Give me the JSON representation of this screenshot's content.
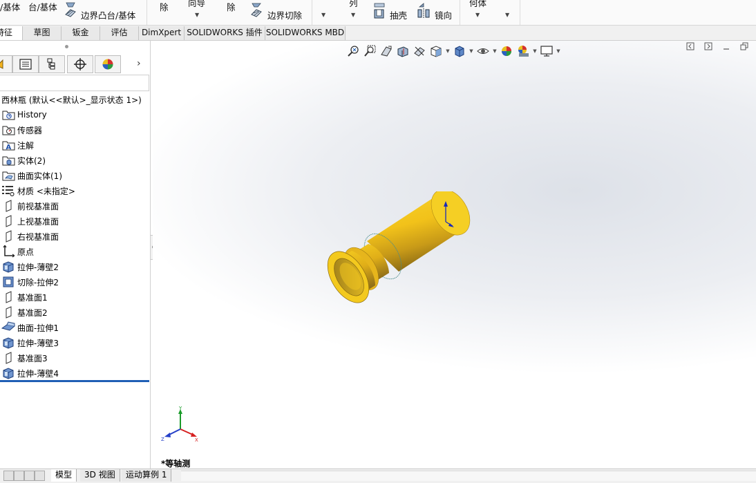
{
  "ribbon": {
    "items": [
      {
        "id": "boss_base_cut",
        "label": "/基体"
      },
      {
        "id": "boss_base",
        "label": "台/基体"
      },
      {
        "id": "boundary_boss",
        "label": "边界凸台/基体"
      },
      {
        "id": "cut_1",
        "label": "除"
      },
      {
        "id": "guide",
        "label": "向导"
      },
      {
        "id": "cut_2",
        "label": "除"
      },
      {
        "id": "boundary_cut",
        "label": "边界切除"
      },
      {
        "id": "pattern",
        "label": "列"
      },
      {
        "id": "shell",
        "label": "抽壳"
      },
      {
        "id": "mirror",
        "label": "镜向"
      },
      {
        "id": "geometry",
        "label": "何体"
      }
    ]
  },
  "tabs": [
    {
      "label": "特征"
    },
    {
      "label": "草图"
    },
    {
      "label": "钣金"
    },
    {
      "label": "评估"
    },
    {
      "label": "DimXpert"
    },
    {
      "label": "SOLIDWORKS 插件"
    },
    {
      "label": "SOLIDWORKS MBD"
    }
  ],
  "tree": {
    "root": "西林瓶  (默认<<默认>_显示状态 1>)",
    "items": [
      {
        "label": "History",
        "icon": "history-folder-icon"
      },
      {
        "label": "传感器",
        "icon": "sensor-folder-icon"
      },
      {
        "label": "注解",
        "icon": "annotation-folder-icon"
      },
      {
        "label": "实体(2)",
        "icon": "solid-bodies-folder-icon"
      },
      {
        "label": "曲面实体(1)",
        "icon": "surface-bodies-folder-icon"
      },
      {
        "label": "材质 <未指定>",
        "icon": "material-icon"
      },
      {
        "label": "前视基准面",
        "icon": "plane-icon"
      },
      {
        "label": "上视基准面",
        "icon": "plane-icon"
      },
      {
        "label": "右视基准面",
        "icon": "plane-icon"
      },
      {
        "label": "原点",
        "icon": "origin-icon"
      },
      {
        "label": "拉伸-薄壁2",
        "icon": "extrude-thin-icon"
      },
      {
        "label": "切除-拉伸2",
        "icon": "cut-extrude-icon"
      },
      {
        "label": "基准面1",
        "icon": "plane-icon"
      },
      {
        "label": "基准面2",
        "icon": "plane-icon"
      },
      {
        "label": "曲面-拉伸1",
        "icon": "surface-extrude-icon"
      },
      {
        "label": "拉伸-薄壁3",
        "icon": "extrude-thin-icon"
      },
      {
        "label": "基准面3",
        "icon": "plane-icon"
      },
      {
        "label": "拉伸-薄壁4",
        "icon": "extrude-thin-icon"
      }
    ]
  },
  "graphics": {
    "view_label": "*等轴测",
    "triad": {
      "x": "X",
      "y": "Y",
      "z": "Z"
    }
  },
  "bottom_tabs": [
    {
      "label": "模型"
    },
    {
      "label": "3D 视图"
    },
    {
      "label": "运动算例 1"
    }
  ],
  "colors": {
    "part_yellow": "#f2c21a",
    "part_shadow": "#a07a10",
    "rollback_bar": "#1f5fb5",
    "axis_x": "#d62020",
    "axis_y": "#1a9a2a",
    "axis_z": "#2540c8"
  }
}
